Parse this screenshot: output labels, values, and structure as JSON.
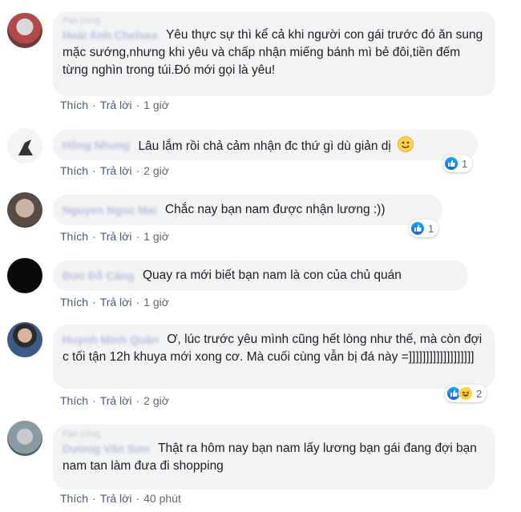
{
  "actions": {
    "like": "Thích",
    "reply": "Trả lời",
    "separator": "·"
  },
  "comments": [
    {
      "meta": "Fan cứng",
      "author": "Hoài Anh Chelsea",
      "text": "Yêu thực sự thì kể cả khi người con gái trước đó ăn sung mặc sướng,nhưng khi yêu và chấp nhận miếng bánh mì bẻ đôi,tiền đếm từng nghìn trong túi.Đó mới gọi là yêu!",
      "time": "1 giờ",
      "reactions": null
    },
    {
      "meta": "",
      "author": "Hồng Nhung",
      "text": "Lâu lắm rồi chả cảm nhận đc thứ gì dù giản dị",
      "emoji": "smiley",
      "time": "2 giờ",
      "reactions": {
        "types": [
          "like"
        ],
        "count": "1"
      }
    },
    {
      "meta": "",
      "author": "Nguyen Ngoc Mai",
      "text": "Chắc nay bạn nam được nhận lương :))",
      "time": "1 giờ",
      "reactions": {
        "types": [
          "like"
        ],
        "count": "1"
      }
    },
    {
      "meta": "",
      "author": "Đức Đỗ Càng",
      "text": "Quay ra mới biết bạn nam là con của chủ quán",
      "time": "1 giờ",
      "reactions": null
    },
    {
      "meta": "",
      "author": "Huỳnh Minh Quân",
      "text": "Ơ, lúc trước yêu mình cũng hết lòng như thế, mà còn đợi c tối tận 12h khuya mới xong cơ. Mà cuối cùng vẫn bị đá này =]]]]]]]]]]]]]]]]]]]",
      "time": "2 giờ",
      "reactions": {
        "types": [
          "like",
          "haha"
        ],
        "count": "2"
      }
    },
    {
      "meta": "Fan cứng",
      "author": "Dương Văn Sơn",
      "text": "Thật ra hôm nay bạn nam lấy lương bạn gái đang đợi bạn nam tan làm đưa đi shopping",
      "time": "40 phút",
      "reactions": null
    }
  ],
  "colors": {
    "link": "#4b5a7a",
    "bubble": "#f2f3f5",
    "like": "#1877f2"
  }
}
